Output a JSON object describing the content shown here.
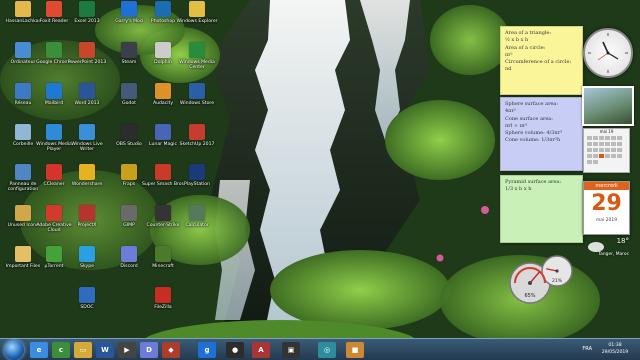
{
  "desktop": {
    "icons": [
      {
        "label": "HassanLachkar",
        "color": "#e5b84b",
        "glyph": "folder-icon"
      },
      {
        "label": "Ordinateur",
        "color": "#4a8bd6",
        "glyph": "computer-icon"
      },
      {
        "label": "Réseau",
        "color": "#3e79c5",
        "glyph": "network-icon"
      },
      {
        "label": "Corbeille",
        "color": "#8fb7d6",
        "glyph": "recycle-bin-icon"
      },
      {
        "label": "Panneau de configuration",
        "color": "#4f86c6",
        "glyph": "control-panel-icon"
      },
      {
        "label": "Unused Icons",
        "color": "#d0a84a",
        "glyph": "folder-icon"
      },
      {
        "label": "Important Files",
        "color": "#e3c066",
        "glyph": "folder-icon"
      },
      {
        "label": "Foxit Reader",
        "color": "#e04a2e",
        "glyph": "pdf-icon"
      },
      {
        "label": "Google Chrome",
        "color": "#3b8f3b",
        "glyph": "chrome-icon"
      },
      {
        "label": "Mailbird",
        "color": "#1f79d2",
        "glyph": "mail-icon"
      },
      {
        "label": "Windows Media Player",
        "color": "#2f8ad8",
        "glyph": "media-player-icon"
      },
      {
        "label": "CCleaner",
        "color": "#d6332d",
        "glyph": "ccleaner-icon"
      },
      {
        "label": "Adobe Creative Cloud",
        "color": "#d23a2b",
        "glyph": "adobe-icon"
      },
      {
        "label": "µTorrent",
        "color": "#43a33a",
        "glyph": "torrent-icon"
      },
      {
        "label": "Excel 2013",
        "color": "#1f7a40",
        "glyph": "excel-icon"
      },
      {
        "label": "PowerPoint 2013",
        "color": "#c8462a",
        "glyph": "powerpoint-icon"
      },
      {
        "label": "Word 2013",
        "color": "#2a5699",
        "glyph": "word-icon"
      },
      {
        "label": "Windows Live Writer",
        "color": "#3a8fd8",
        "glyph": "writer-icon"
      },
      {
        "label": "Wondershare",
        "color": "#e7b21f",
        "glyph": "wondershare-icon"
      },
      {
        "label": "ProjectX",
        "color": "#b7332d",
        "glyph": "project-icon"
      },
      {
        "label": "Skype",
        "color": "#2aa0e4",
        "glyph": "skype-icon"
      },
      {
        "label": "SDOC",
        "color": "#2f6bbf",
        "glyph": "doc-icon"
      },
      {
        "label": "Garry's Mod",
        "color": "#1e6fd6",
        "glyph": "gmod-icon"
      },
      {
        "label": "Steam",
        "color": "#3a3f49",
        "glyph": "steam-icon"
      },
      {
        "label": "Godot",
        "color": "#455a78",
        "glyph": "game-icon"
      },
      {
        "label": "OBS Studio",
        "color": "#2c2c2c",
        "glyph": "obs-icon"
      },
      {
        "label": "Fraps",
        "color": "#c8a01e",
        "glyph": "fraps-icon"
      },
      {
        "label": "GIMP",
        "color": "#6a6a6a",
        "glyph": "gimp-icon"
      },
      {
        "label": "Discord",
        "color": "#6e7bd8",
        "glyph": "discord-icon"
      },
      {
        "label": "Photoshop",
        "color": "#1b6cb0",
        "glyph": "photoshop-icon"
      },
      {
        "label": "Dolphin",
        "color": "#ccc",
        "glyph": "app-icon"
      },
      {
        "label": "Audacity",
        "color": "#e0902a",
        "glyph": "audacity-icon"
      },
      {
        "label": "Lunar Magic",
        "color": "#4966b6",
        "glyph": "app-icon"
      },
      {
        "label": "Super Smash Bros",
        "color": "#ca3a2a",
        "glyph": "game-icon"
      },
      {
        "label": "Counter-Strike",
        "color": "#343434",
        "glyph": "game-icon"
      },
      {
        "label": "Minecraft",
        "color": "#4b7a2d",
        "glyph": "game-icon"
      },
      {
        "label": "FileZilla",
        "color": "#c72d22",
        "glyph": "filezilla-icon"
      },
      {
        "label": "Windows Explorer",
        "color": "#e4bd45",
        "glyph": "explorer-icon"
      },
      {
        "label": "Windows Media Center",
        "color": "#2a8c3a",
        "glyph": "media-center-icon"
      },
      {
        "label": "Windows Store",
        "color": "#2a5fa5",
        "glyph": "store-icon"
      },
      {
        "label": "SketchUp 2017",
        "color": "#c63c30",
        "glyph": "sketchup-icon"
      },
      {
        "label": "PlayStation",
        "color": "#1b3a7a",
        "glyph": "playstation-icon"
      },
      {
        "label": "Calculator",
        "color": "#54795b",
        "glyph": "calculator-icon"
      }
    ]
  },
  "notes": {
    "note1": {
      "lines": [
        "Area of a triangle:",
        "½ x b x h",
        "Area of a circle:",
        "πr²",
        "Circumference of a circle:",
        "πd"
      ]
    },
    "note2": {
      "lines": [
        "Sphere surface area:",
        "4πr²",
        "Cone surface area:",
        "πrl + πr²",
        "Sphere volume: 4/3πr³",
        "Cone volume: 1/3πr²h"
      ]
    },
    "note3": {
      "lines": [
        "Pyramid surface area:",
        "1/3 x b x h"
      ]
    }
  },
  "widgets": {
    "calendar": {
      "weekday": "mercredi",
      "day": "29",
      "month_year": "mai 2019",
      "small_header": "mai 19"
    },
    "weather": {
      "temperature": "18°",
      "city": "Tanger, Maroc"
    },
    "gauge": {
      "cpu_percent": 65,
      "ram_percent": 21,
      "cpu_text": "65%",
      "ram_text": "21%"
    }
  },
  "taskbar": {
    "items": [
      {
        "name": "internet-explorer",
        "color": "#3a8de0",
        "glyph": "e"
      },
      {
        "name": "chrome",
        "color": "#3b8f3b",
        "glyph": "c"
      },
      {
        "name": "explorer",
        "color": "#d4a93a",
        "glyph": "▭"
      },
      {
        "name": "word",
        "color": "#2a5699",
        "glyph": "W"
      },
      {
        "name": "media",
        "color": "#444",
        "glyph": "▶"
      },
      {
        "name": "discord",
        "color": "#6e7bd8",
        "glyph": "D"
      },
      {
        "name": "game",
        "color": "#ad3c2a",
        "glyph": "◆"
      },
      {
        "name": "gmod",
        "color": "#1e6fd6",
        "glyph": "g"
      },
      {
        "name": "obs",
        "color": "#2c2c2c",
        "glyph": "●"
      },
      {
        "name": "app",
        "color": "#a33",
        "glyph": "A"
      },
      {
        "name": "app2",
        "color": "#333",
        "glyph": "▣"
      },
      {
        "name": "app3",
        "color": "#2d8d9d",
        "glyph": "◎"
      },
      {
        "name": "app4",
        "color": "#c83",
        "glyph": "■"
      }
    ],
    "tray": {
      "language": "FRA",
      "time": "01:38",
      "date": "29/05/2019"
    }
  }
}
